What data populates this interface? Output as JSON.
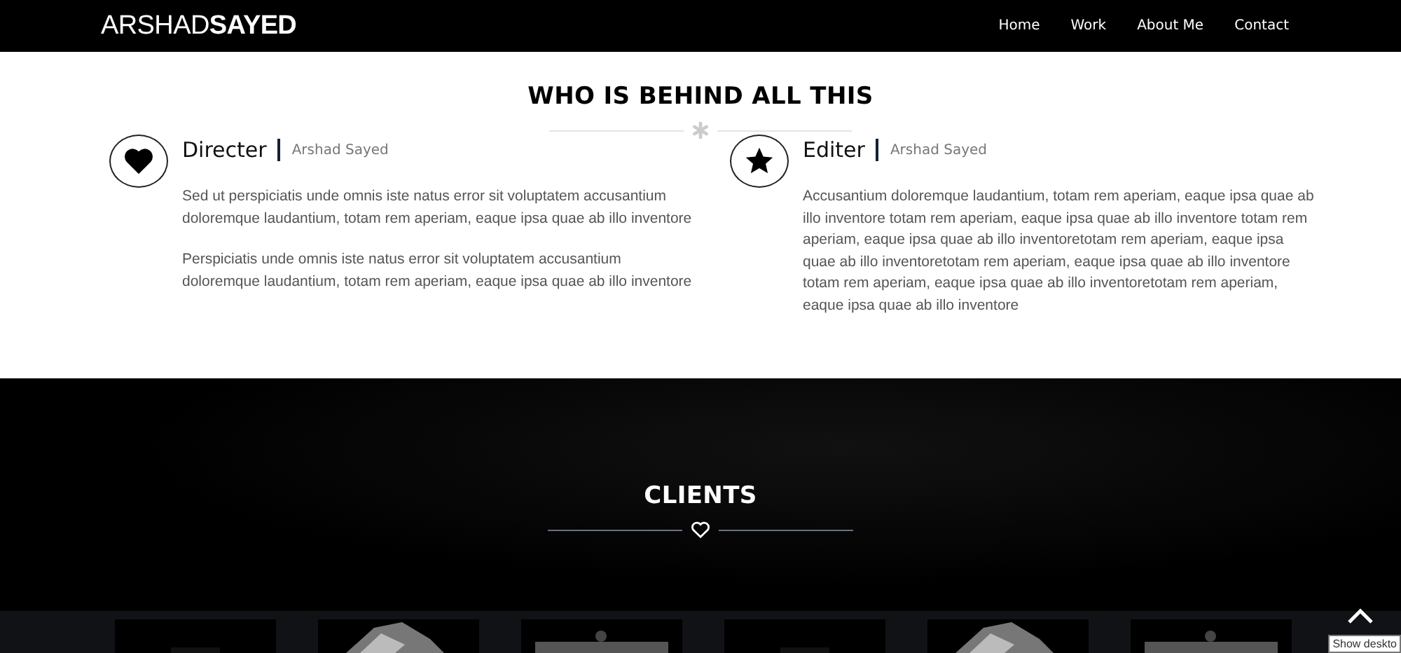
{
  "nav": {
    "brand": "ARSHAD**SAYED**",
    "links": [
      "Home",
      "Work",
      "About Me",
      "Contact"
    ]
  },
  "about": {
    "title": "WHO IS BEHIND ALL THIS",
    "members": [
      {
        "kind": "heart",
        "role": "Directer",
        "name": "Arshad Sayed",
        "paragraphs": [
          "Sed ut perspiciatis unde omnis iste natus error sit voluptatem accusantium doloremque laudantium, totam rem aperiam, eaque ipsa quae ab illo inventore",
          "Perspiciatis unde omnis iste natus error sit voluptatem accusantium doloremque laudantium, totam rem aperiam, eaque ipsa quae ab illo inventore"
        ]
      },
      {
        "kind": "star",
        "role": "Editer",
        "name": "Arshad Sayed",
        "paragraphs": [
          "Accusantium doloremque laudantium, totam rem aperiam, eaque ipsa quae ab illo inventore totam rem aperiam, eaque ipsa quae ab illo inventore totam rem aperiam, eaque ipsa quae ab illo inventoretotam rem aperiam, eaque ipsa quae ab illo inventoretotam rem aperiam, eaque ipsa quae ab illo inventore totam rem aperiam, eaque ipsa quae ab illo inventoretotam rem aperiam, eaque ipsa quae ab illo inventore"
        ]
      }
    ]
  },
  "clients": {
    "title": "CLIENTS"
  },
  "tooltip": "Show deskto"
}
